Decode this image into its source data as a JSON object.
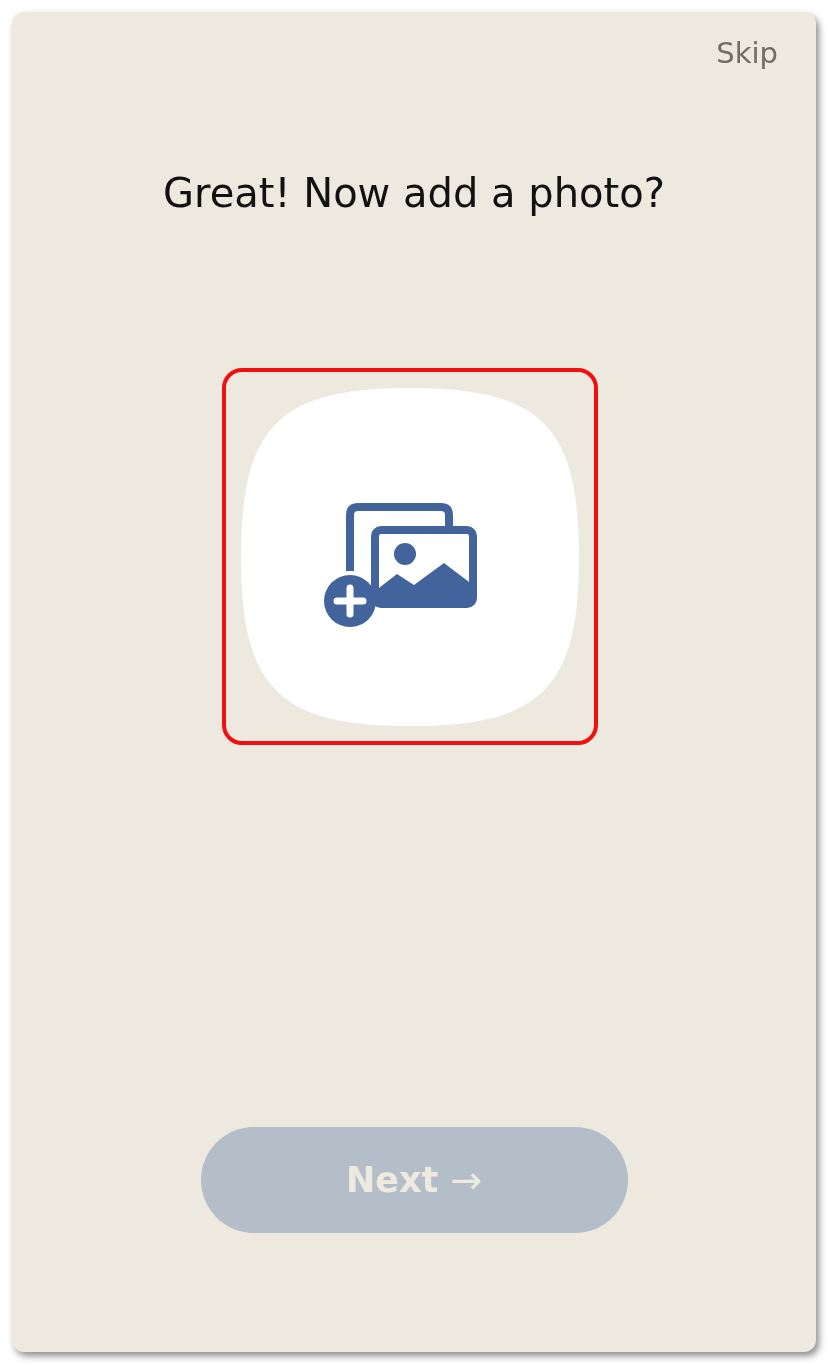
{
  "header": {
    "skip_label": "Skip"
  },
  "title": "Great! Now add a photo?",
  "photo_picker": {
    "highlighted": true
  },
  "next_button": {
    "label": "Next",
    "arrow": "→",
    "disabled": true
  }
}
